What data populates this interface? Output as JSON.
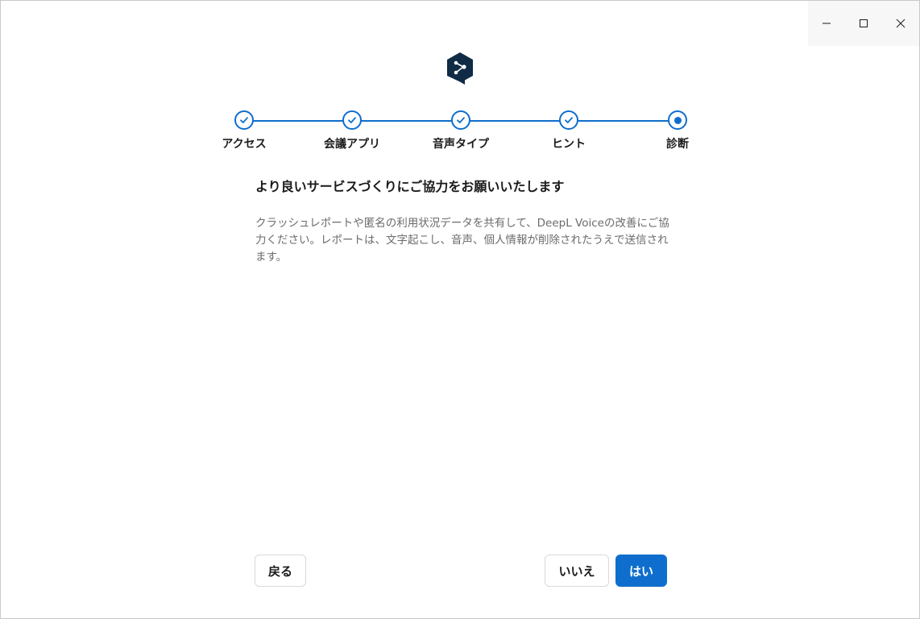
{
  "window": {
    "caption": {
      "minimize": "minimize-icon",
      "maximize": "maximize-icon",
      "close": "close-icon"
    }
  },
  "logo": {
    "icon": "deepl-logo-icon",
    "color": "#0f2b46"
  },
  "stepper": {
    "steps": [
      {
        "label": "アクセス",
        "state": "done"
      },
      {
        "label": "会議アプリ",
        "state": "done"
      },
      {
        "label": "音声タイプ",
        "state": "done"
      },
      {
        "label": "ヒント",
        "state": "done"
      },
      {
        "label": "診断",
        "state": "current"
      }
    ],
    "accent": "#0f6ecd"
  },
  "content": {
    "heading": "より良いサービスづくりにご協力をお願いいたします",
    "description": "クラッシュレポートや匿名の利用状況データを共有して、DeepL Voiceの改善にご協力ください。レポートは、文字起こし、音声、個人情報が削除されたうえで送信されます。"
  },
  "footer": {
    "back_label": "戻る",
    "no_label": "いいえ",
    "yes_label": "はい",
    "primary_color": "#0f6ecd"
  }
}
